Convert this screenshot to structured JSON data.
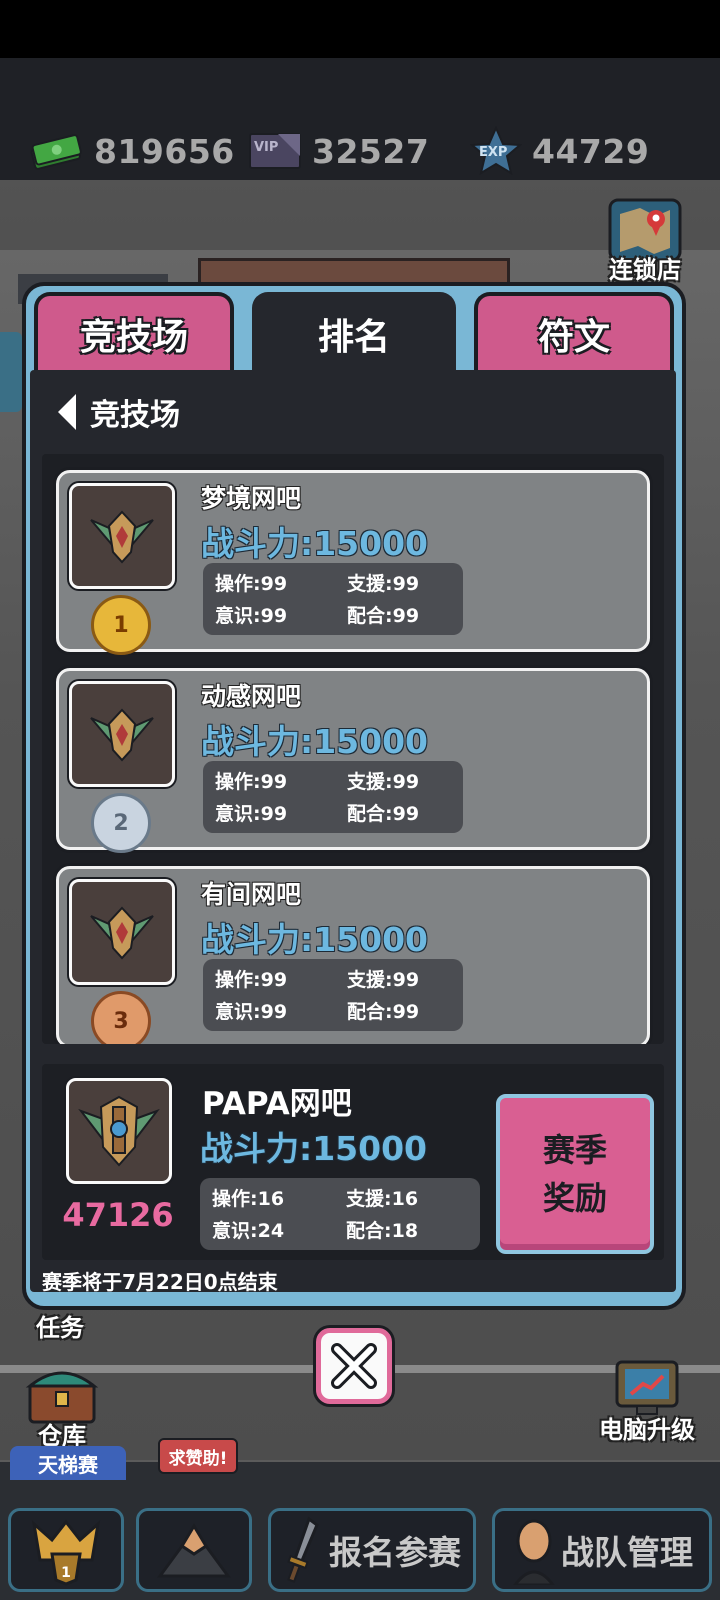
{
  "currencies": [
    {
      "icon": "cash-icon",
      "value": "819656"
    },
    {
      "icon": "vip-ticket-icon",
      "value": "32527",
      "icon_text": "VIP"
    },
    {
      "icon": "exp-star-icon",
      "value": "44729",
      "icon_text": "EXP"
    }
  ],
  "side": {
    "chain_store": "连锁店",
    "task": "任务",
    "warehouse": "仓库",
    "pc_upgrade": "电脑升级"
  },
  "tabs": [
    "竞技场",
    "排名",
    "符文"
  ],
  "active_tab": "排名",
  "back_label": "竞技场",
  "ranking": [
    {
      "rank": "1",
      "name": "梦境网吧",
      "power": "战斗力:15000",
      "stats": [
        "操作:99",
        "支援:99",
        "意识:99",
        "配合:99"
      ],
      "medal": "gold"
    },
    {
      "rank": "2",
      "name": "动感网吧",
      "power": "战斗力:15000",
      "stats": [
        "操作:99",
        "支援:99",
        "意识:99",
        "配合:99"
      ],
      "medal": "silver"
    },
    {
      "rank": "3",
      "name": "有间网吧",
      "power": "战斗力:15000",
      "stats": [
        "操作:99",
        "支援:99",
        "意识:99",
        "配合:99"
      ],
      "medal": "bronze"
    }
  ],
  "me": {
    "name": "PAPA网吧",
    "power": "战斗力:15000",
    "rank": "47126",
    "stats": [
      "操作:16",
      "支援:16",
      "意识:24",
      "配合:18"
    ]
  },
  "reward_button": [
    "赛季",
    "奖励"
  ],
  "season_note": "赛季将于7月22日0点结束",
  "bottom": {
    "ladder_tag": "天梯赛",
    "help_tag": "求赞助!",
    "signup": "报名参赛",
    "team": "战队管理"
  },
  "colors": {
    "accent_pink": "#cf5a8c",
    "frame_blue": "#7ab7d5",
    "power_blue": "#6db8e0",
    "rank_pink": "#e86aa0"
  }
}
